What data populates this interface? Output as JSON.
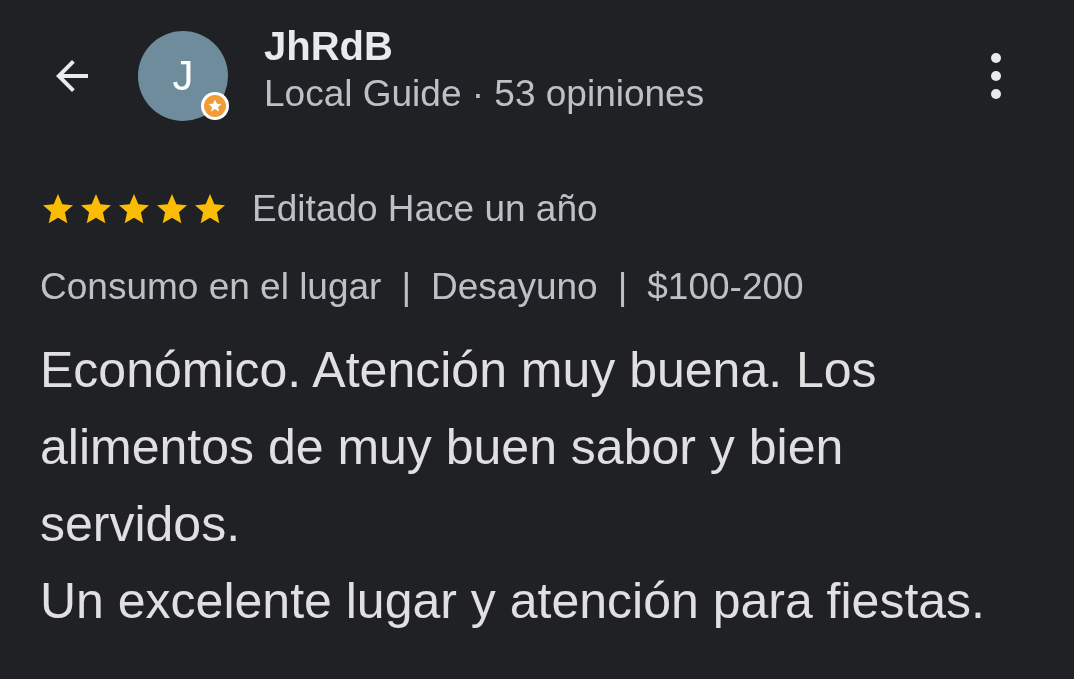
{
  "header": {
    "author": "JhRdB",
    "avatar_letter": "J",
    "subtitle": "Local Guide · 53 opiniones"
  },
  "review": {
    "stars": 5,
    "date": "Editado Hace un año",
    "tags": [
      "Consumo en el lugar",
      "Desayuno",
      "$100-200"
    ],
    "tag_separator": "|",
    "text": "Económico. Atención muy buena. Los alimentos de muy buen sabor y bien servidos.\nUn excelente lugar y atención para fiestas."
  }
}
